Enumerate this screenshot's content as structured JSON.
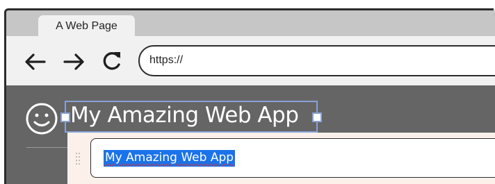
{
  "browser": {
    "tab_title": "A Web Page",
    "url": "https://",
    "nav_icons": [
      "back-arrow-icon",
      "forward-arrow-icon",
      "reload-icon"
    ]
  },
  "app": {
    "logo_icon": "smiley-face-icon",
    "title": "My Amazing Web App"
  },
  "editor": {
    "value": "My Amazing Web App",
    "selected": true,
    "grip_icon": "drag-grip-icon"
  },
  "colors": {
    "header_bg": "#656565",
    "selection_outline": "#8aa2d8",
    "text_selection": "#1a73e8",
    "editor_panel": "#fbf1ea"
  }
}
